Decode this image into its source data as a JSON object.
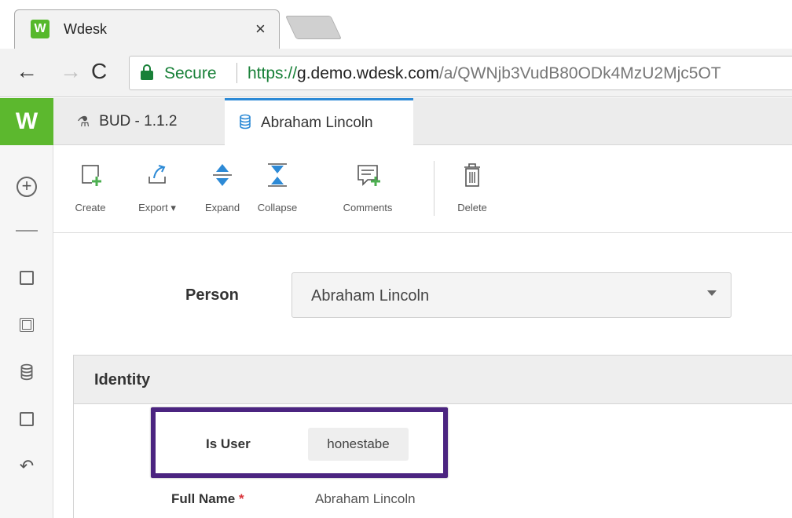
{
  "browser": {
    "tab_title": "Wdesk",
    "favicon_letter": "W",
    "close_glyph": "×",
    "secure_label": "Secure",
    "url_scheme": "https://",
    "url_domain": "g.demo.wdesk.com",
    "url_path": "/a/QWNjb3VudB80ODk4MzU2Mjc5OT"
  },
  "app": {
    "logo": "W",
    "tabs": [
      {
        "label": "BUD - 1.1.2",
        "icon": "flask-icon"
      },
      {
        "label": "Abraham Lincoln",
        "icon": "database-icon",
        "active": true
      }
    ],
    "accent_color": "#2d8ad6",
    "brand_color": "#5cb82e"
  },
  "actions": {
    "create": "Create",
    "export": "Export",
    "expand": "Expand",
    "collapse": "Collapse",
    "comments": "Comments",
    "delete": "Delete"
  },
  "form": {
    "person_label": "Person",
    "person_value": "Abraham Lincoln",
    "section_title": "Identity",
    "is_user_label": "Is User",
    "is_user_value": "honestabe",
    "full_name_label": "Full Name",
    "required_mark": "*",
    "full_name_value": "Abraham Lincoln",
    "highlight_color": "#4b2480"
  }
}
